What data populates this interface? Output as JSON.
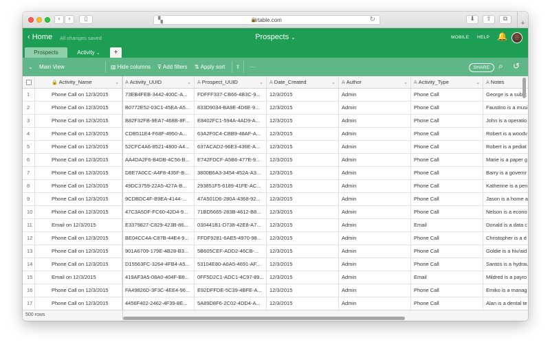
{
  "browser": {
    "url": "airtable.com"
  },
  "header": {
    "home_label": "Home",
    "saved_status": "All changes saved",
    "base_title": "Prospects",
    "mobile_label": "MOBILE",
    "help_label": "HELP"
  },
  "tabs": [
    {
      "label": "Prospects"
    },
    {
      "label": "Activity"
    },
    {
      "label": "+"
    }
  ],
  "view_bar": {
    "view_name": "Main View",
    "hide_columns": "Hide columns",
    "add_filters": "Add filters",
    "apply_sort": "Apply sort",
    "share_label": "SHARE"
  },
  "columns": [
    "Activity_Name",
    "Activity_UUID",
    "Prospect_UUID",
    "Date_Created",
    "Author",
    "Activity_Type",
    "Notes"
  ],
  "rows": [
    {
      "n": "1",
      "name": "Phone Call on 12/3/2015",
      "auid": "73EB4FEB-3442-400C-A...",
      "puid": "FDFFF337-CB66-4B3C-9...",
      "date": "12/3/2015",
      "author": "Admin",
      "type": "Phone Call",
      "notes": "George is a subst"
    },
    {
      "n": "2",
      "name": "Phone Call on 12/3/2015",
      "auid": "B0772E52-03C1-45EA-A5...",
      "puid": "833D9034-BA9E-4D6E-9...",
      "date": "12/3/2015",
      "author": "Admin",
      "type": "Phone Call",
      "notes": "Faustino is a musi"
    },
    {
      "n": "3",
      "name": "Phone Call on 12/3/2015",
      "auid": "B82F32FB-9EA7-468B-8F...",
      "puid": "E8402FC1-594A-4AD9-A...",
      "date": "12/3/2015",
      "author": "Admin",
      "type": "Phone Call",
      "notes": "John is a operatio"
    },
    {
      "n": "4",
      "name": "Phone Call on 12/3/2015",
      "auid": "CDB511E4-F68F-4950-A...",
      "puid": "63A2F0C4-CBB9-48AF-A...",
      "date": "12/3/2015",
      "author": "Admin",
      "type": "Phone Call",
      "notes": "Robert is a woodv"
    },
    {
      "n": "5",
      "name": "Phone Call on 12/3/2015",
      "auid": "52CFC4A6-8521-4800-A4...",
      "puid": "637ACAD2-96E3-436E-A...",
      "date": "12/3/2015",
      "author": "Admin",
      "type": "Phone Call",
      "notes": "Robert is a pediat"
    },
    {
      "n": "6",
      "name": "Phone Call on 12/3/2015",
      "auid": "AA4DA2F6-B4DB-4C56-B...",
      "puid": "E742FDCF-A5B6-477E-9...",
      "date": "12/3/2015",
      "author": "Admin",
      "type": "Phone Call",
      "notes": "Marie is a paper g"
    },
    {
      "n": "7",
      "name": "Phone Call on 12/3/2015",
      "auid": "D8E7A0CC-A4F8-435F-B...",
      "puid": "3800B6A3-3454-452A-A3...",
      "date": "12/3/2015",
      "author": "Admin",
      "type": "Phone Call",
      "notes": "Barry is a governr"
    },
    {
      "n": "8",
      "name": "Phone Call on 12/3/2015",
      "auid": "49DC3759-22A5-427A-B...",
      "puid": "293851F5-6189-41FE-AC...",
      "date": "12/3/2015",
      "author": "Admin",
      "type": "Phone Call",
      "notes": "Katherine is a pen"
    },
    {
      "n": "9",
      "name": "Phone Call on 12/3/2015",
      "auid": "9CDBDC4F-B9EA-4144-...",
      "puid": "47A501D6-280A-4368-92...",
      "date": "12/3/2015",
      "author": "Admin",
      "type": "Phone Call",
      "notes": "Jason is a home a"
    },
    {
      "n": "10",
      "name": "Phone Call on 12/3/2015",
      "auid": "47C3A5DF-FC60-42D4-9...",
      "puid": "71BD5665-283B-4612-B8...",
      "date": "12/3/2015",
      "author": "Admin",
      "type": "Phone Call",
      "notes": "Nelson is a econo"
    },
    {
      "n": "11",
      "name": "Email on 12/3/2015",
      "auid": "E3379827-C829-423B-86...",
      "puid": "030441B1-D738-42E8-A7...",
      "date": "12/3/2015",
      "author": "Admin",
      "type": "Email",
      "notes": "Donald is a data c"
    },
    {
      "n": "12",
      "name": "Phone Call on 12/3/2015",
      "auid": "BE04CC4A-C87B-44E4-9...",
      "puid": "FFDF9281-6AE5-4970-98...",
      "date": "12/3/2015",
      "author": "Admin",
      "type": "Phone Call",
      "notes": "Christopher is a d"
    },
    {
      "n": "13",
      "name": "Phone Call on 12/3/2015",
      "auid": "901A6709-179E-4B28-B3...",
      "puid": "5B605CEF-ADD2-46CB-...",
      "date": "12/3/2015",
      "author": "Admin",
      "type": "Phone Call",
      "notes": "Goldie is a hiv/aid"
    },
    {
      "n": "14",
      "name": "Phone Call on 12/3/2015",
      "auid": "D15563FC-3264-4FB4-A5...",
      "puid": "53104E80-A6A5-4691-AF...",
      "date": "12/3/2015",
      "author": "Admin",
      "type": "Phone Call",
      "notes": "Santos is a hydrau"
    },
    {
      "n": "15",
      "name": "Email on 12/3/2015",
      "auid": "419AF3A5-08A0-404F-B8...",
      "puid": "0FF5D2C1-ADC1-4C97-89...",
      "date": "12/3/2015",
      "author": "Admin",
      "type": "Email",
      "notes": "Mildred is a payro"
    },
    {
      "n": "16",
      "name": "Phone Call on 12/3/2015",
      "auid": "FA49826D-3F3C-4EE4-96...",
      "puid": "E92DFFDE-5C39-4BFE-A...",
      "date": "12/3/2015",
      "author": "Admin",
      "type": "Phone Call",
      "notes": "Emiko is a manag"
    },
    {
      "n": "17",
      "name": "Phone Call on 12/3/2015",
      "auid": "4456F402-2462-4F39-8E...",
      "puid": "5A89D8F6-2C02-4DD4-A...",
      "date": "12/3/2015",
      "author": "Admin",
      "type": "Phone Call",
      "notes": "Alan is a dental te"
    }
  ],
  "footer": {
    "row_count": "500 rows"
  },
  "colors": {
    "header_green": "#1e9e55",
    "viewbar_green": "#5fb787"
  }
}
